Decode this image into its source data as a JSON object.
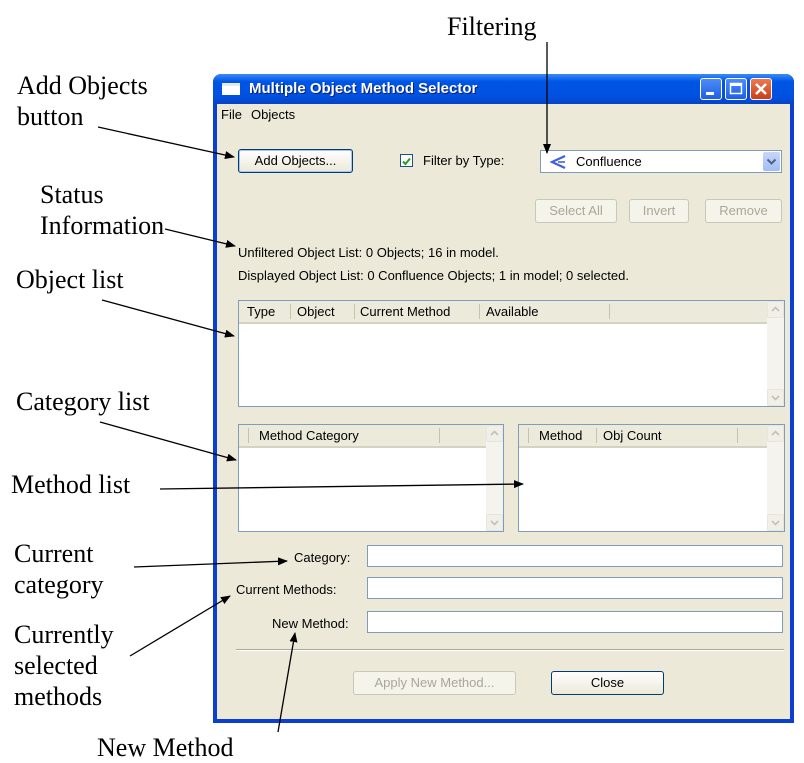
{
  "callouts": {
    "filtering": "Filtering",
    "add_objects": "Add Objects\nbutton",
    "status": "Status\nInformation",
    "object_list": "Object list",
    "category_list": "Category list",
    "method_list": "Method list",
    "current_category": "Current\ncategory",
    "current_methods": "Currently\nselected\nmethods",
    "new_method": "New Method"
  },
  "window": {
    "title": "Multiple Object Method Selector",
    "menu": [
      "File",
      "Objects"
    ]
  },
  "toolbar": {
    "add_objects_label": "Add Objects...",
    "filter_checked": true,
    "filter_label": "Filter by Type:",
    "filter_type_value": "Confluence",
    "filter_type_icon": "confluence-icon",
    "select_all_label": "Select All",
    "invert_label": "Invert",
    "remove_label": "Remove"
  },
  "status": {
    "unfiltered": "Unfiltered Object List:  0 Objects;  16 in model.",
    "displayed": "Displayed Object List:  0 Confluence Objects;  1 in model;  0 selected."
  },
  "object_list": {
    "columns": [
      "Type",
      "Object",
      "Current Method",
      "Available"
    ],
    "rows": []
  },
  "category_list": {
    "columns": [
      "Method Category"
    ],
    "rows": []
  },
  "method_list": {
    "columns": [
      "Method",
      "Obj Count"
    ],
    "rows": []
  },
  "fields": {
    "category_label": "Category:",
    "category_value": "",
    "current_methods_label": "Current Methods:",
    "current_methods_value": "",
    "new_method_label": "New Method:",
    "new_method_value": ""
  },
  "footer": {
    "apply_label": "Apply New Method...",
    "close_label": "Close"
  },
  "colors": {
    "titlebar": "#0055e5",
    "dialog_bg": "#ece9d8",
    "close_button": "#d4532a",
    "confluence_icon": "#4060e0"
  }
}
